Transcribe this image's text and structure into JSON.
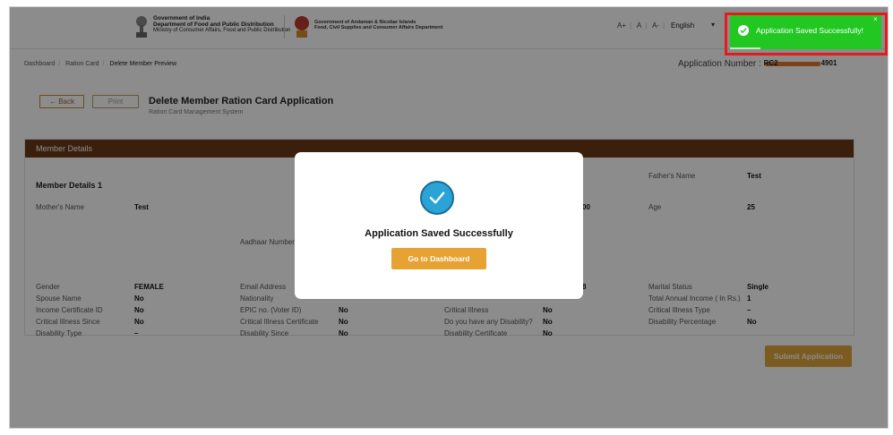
{
  "header": {
    "gov_line1": "Government of India",
    "gov_line2": "Department of Food and Public Distribution",
    "gov_line3": "Ministry of Consumer Affairs, Food and Public Distribution",
    "an_line1": "Government of Andaman & Nicobar Islands",
    "an_line2": "Food, Civil Supplies and Consumer Affairs Department",
    "font_large": "A+",
    "font_normal": "A",
    "font_small": "A-",
    "language": "English"
  },
  "breadcrumb": {
    "items": [
      "Dashboard",
      "Ration Card",
      "Delete Member Preview"
    ]
  },
  "application_number": {
    "label": "Application Number :",
    "prefix": "RC2",
    "suffix": "4901"
  },
  "actions": {
    "back_label": "← Back",
    "print_label": "Print",
    "submit_label": "Submit Application"
  },
  "page": {
    "title": "Delete Member Ration Card Application",
    "subtitle": "Ration Card Management System"
  },
  "panel": {
    "title": "Member Details",
    "section_title": "Member Details 1",
    "fathers_name_label": "Father's Name",
    "fathers_name_value": "Test",
    "mothers_name_label": "Mother's Name",
    "mothers_name_value": "Test",
    "age_label": "Age",
    "age_value": "25",
    "partial_value_1": "00",
    "partial_value_2": "8",
    "aadhaar_label": "Aadhaar Number",
    "rows": [
      {
        "l1": "Gender",
        "v1": "FEMALE",
        "l2": "Email Address",
        "v2": "",
        "l3": "",
        "v3": "",
        "l4": "Marital Status",
        "v4": "Single"
      },
      {
        "l1": "Spouse Name",
        "v1": "No",
        "l2": "Nationality",
        "v2": "",
        "l3": "",
        "v3": "",
        "l4": "Total Annual Income ( In Rs.)",
        "v4": "1"
      },
      {
        "l1": "Income Certificate ID",
        "v1": "No",
        "l2": "EPIC no. (Voter ID)",
        "v2": "No",
        "l3": "Critical Illness",
        "v3": "No",
        "l4": "Critical Illness Type",
        "v4": "–"
      },
      {
        "l1": "Critical Illness Since",
        "v1": "No",
        "l2": "Critical Illness Certificate",
        "v2": "No",
        "l3": "Do you have any Disability?",
        "v3": "No",
        "l4": "Disability Percentage",
        "v4": "No"
      },
      {
        "l1": "Disability Type",
        "v1": "–",
        "l2": "Disability Since",
        "v2": "No",
        "l3": "Disability Certificate",
        "v3": "No",
        "l4": "",
        "v4": ""
      }
    ]
  },
  "modal": {
    "title": "Application Saved Successfully",
    "button_label": "Go to Dashboard"
  },
  "toast": {
    "message": "Application Saved Successfully!",
    "close": "×"
  },
  "colors": {
    "panel_header": "#6b3b16",
    "accent": "#e6a233",
    "toast": "#22c722",
    "check": "#2aa3d6",
    "highlight": "#e41b1b"
  }
}
